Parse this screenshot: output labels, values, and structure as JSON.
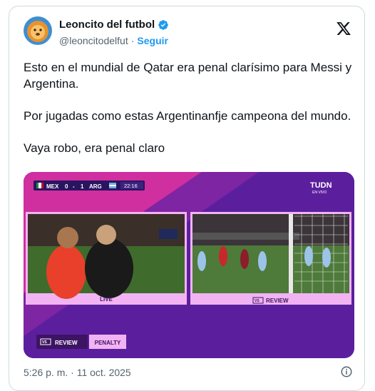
{
  "author": {
    "name": "Leoncito del futbol",
    "handle": "@leoncitodelfut",
    "follow_label": "Seguir",
    "separator": "·"
  },
  "tweet": {
    "paragraphs": [
      "Esto en el mundial de Qatar era penal clarísimo para Messi y Argentina.",
      "Por jugadas como estas Argentinanfje campeona del mundo.",
      "Vaya robo, era penal claro"
    ],
    "timestamp": "5:26 p. m. · 11 oct. 2025"
  },
  "media": {
    "scorebug": {
      "home": "MEX",
      "home_score": "0",
      "separator": "-",
      "away_score": "1",
      "away": "ARG",
      "clock": "22:16"
    },
    "broadcaster": "TUDN",
    "broadcaster_sub": "EN VIVO",
    "left_label": "LIVE",
    "right_vs": "VS",
    "right_label": "REVIEW",
    "bottom_vs": "VS",
    "bottom_review": "REVIEW",
    "bottom_penalty": "PENALTY"
  },
  "colors": {
    "accent": "#1d9bf0",
    "media_purple": "#6a2aa8",
    "media_magenta": "#d02fa0",
    "label_pink": "#f2b3f2"
  },
  "icons": [
    "verified-icon",
    "x-logo-icon",
    "info-icon"
  ]
}
